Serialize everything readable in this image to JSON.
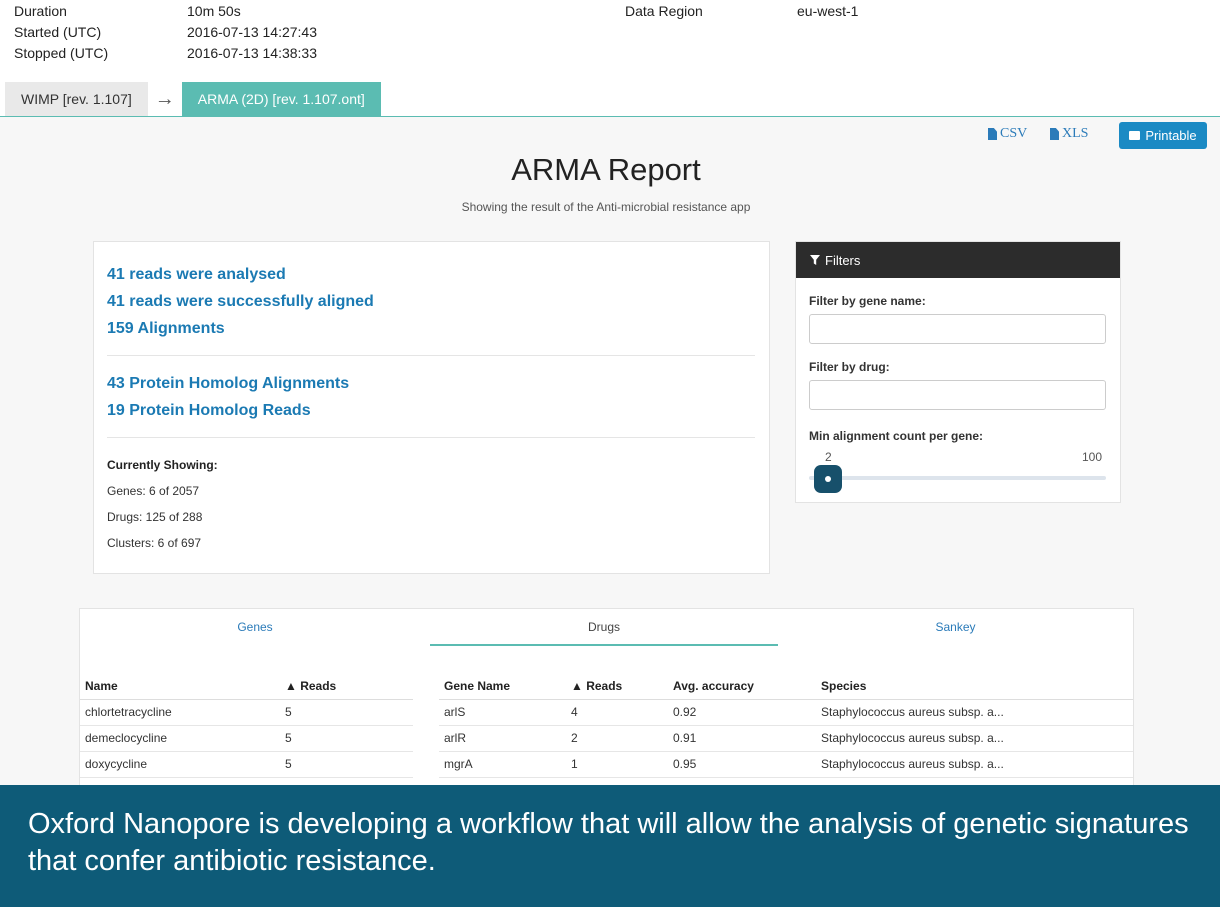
{
  "meta": {
    "duration_label": "Duration",
    "duration_value": "10m 50s",
    "started_label": "Started (UTC)",
    "started_value": "2016-07-13 14:27:43",
    "stopped_label": "Stopped (UTC)",
    "stopped_value": "2016-07-13 14:38:33",
    "region_label": "Data Region",
    "region_value": "eu-west-1"
  },
  "pipeline": {
    "step1": "WIMP [rev. 1.107]",
    "arrow": "→",
    "step2": "ARMA (2D) [rev. 1.107.ont]"
  },
  "export": {
    "csv": "CSV",
    "xls": "XLS",
    "printable": "Printable"
  },
  "report": {
    "title": "ARMA Report",
    "subtitle": "Showing the result of the Anti-microbial resistance app"
  },
  "summary": {
    "stats": [
      "41 reads were analysed",
      "41 reads were successfully aligned",
      "159 Alignments"
    ],
    "homolog": [
      "43 Protein Homolog Alignments",
      "19 Protein Homolog Reads"
    ],
    "currently_showing_title": "Currently Showing:",
    "genes": "Genes: 6 of 2057",
    "drugs": "Drugs: 125 of 288",
    "clusters": "Clusters: 6 of 697"
  },
  "filters": {
    "header": "Filters",
    "gene_label": "Filter by gene name:",
    "gene_value": "",
    "drug_label": "Filter by drug:",
    "drug_value": "",
    "min_label": "Min alignment count per gene:",
    "slider_min": "2",
    "slider_max": "100",
    "slider_value": 2
  },
  "tabs": {
    "genes": "Genes",
    "drugs": "Drugs",
    "sankey": "Sankey"
  },
  "drug_table": {
    "headers": [
      "Name",
      "▲ Reads"
    ],
    "rows": [
      [
        "chlortetracycline",
        "5"
      ],
      [
        "demeclocycline",
        "5"
      ],
      [
        "doxycycline",
        "5"
      ]
    ]
  },
  "gene_table": {
    "headers": [
      "Gene Name",
      "▲ Reads",
      "Avg. accuracy",
      "Species"
    ],
    "rows": [
      [
        "arlS",
        "4",
        "0.92",
        "Staphylococcus aureus subsp. a..."
      ],
      [
        "arlR",
        "2",
        "0.91",
        "Staphylococcus aureus subsp. a..."
      ],
      [
        "mgrA",
        "1",
        "0.95",
        "Staphylococcus aureus subsp. a..."
      ]
    ]
  },
  "banner": {
    "text": "Oxford Nanopore is developing a workflow that will allow the analysis of genetic signatures that confer antibiotic resistance."
  }
}
